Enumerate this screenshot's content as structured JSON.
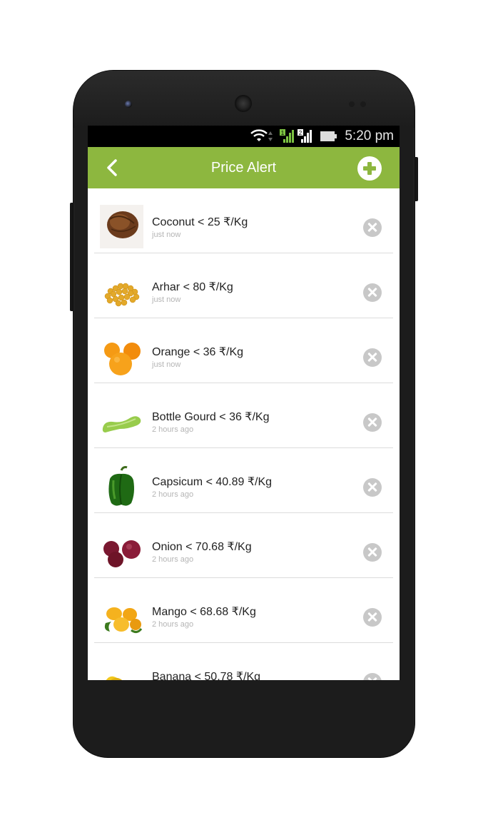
{
  "status_bar": {
    "time": "5:20 pm",
    "sim1": "1",
    "sim2": "2",
    "icons": [
      "wifi-icon",
      "signal-sim1-icon",
      "signal-sim2-icon",
      "battery-icon"
    ]
  },
  "app_bar": {
    "title": "Price Alert",
    "color": "#8db73f",
    "back_icon": "chevron-left-icon",
    "add_icon": "add-circle-icon"
  },
  "alerts": [
    {
      "title": "Coconut < 25 ₹/Kg",
      "time": "just now",
      "image": "coconut"
    },
    {
      "title": "Arhar < 80 ₹/Kg",
      "time": "just now",
      "image": "arhar-dal"
    },
    {
      "title": "Orange < 36 ₹/Kg",
      "time": "just now",
      "image": "orange"
    },
    {
      "title": "Bottle Gourd < 36 ₹/Kg",
      "time": "2 hours ago",
      "image": "bottle-gourd"
    },
    {
      "title": "Capsicum < 40.89 ₹/Kg",
      "time": "2 hours ago",
      "image": "capsicum"
    },
    {
      "title": "Onion < 70.68 ₹/Kg",
      "time": "2 hours ago",
      "image": "onion"
    },
    {
      "title": "Mango < 68.68 ₹/Kg",
      "time": "2 hours ago",
      "image": "mango"
    },
    {
      "title": "Banana < 50.78 ₹/Kg",
      "time": "",
      "image": "banana"
    }
  ]
}
